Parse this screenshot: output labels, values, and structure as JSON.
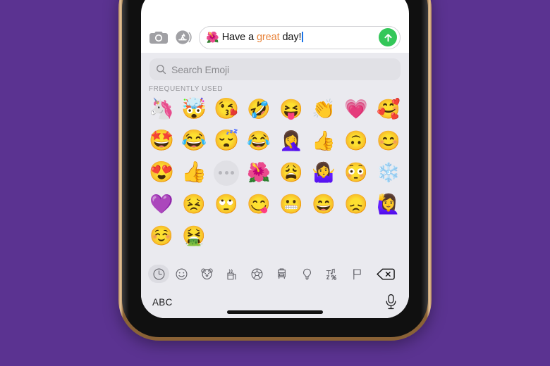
{
  "background": {
    "color": "#5B3391"
  },
  "device": {
    "frame_color": "#b98b5e",
    "bezel_color": "#101010",
    "screen_bg": "#ffffff"
  },
  "compose": {
    "camera_icon": "camera-icon",
    "appstore_icon": "app-store-icon",
    "message_emoji": "🌺",
    "message_text_before": "Have a ",
    "message_text_highlight": "great",
    "message_text_after": " day!",
    "highlight_color": "#E8833A",
    "caret_color": "#1a73e8",
    "send_icon": "send-arrow-up-icon",
    "send_color": "#34C759"
  },
  "keyboard": {
    "background": "#EAEAEF",
    "search": {
      "icon": "search-icon",
      "placeholder": "Search Emoji",
      "value": ""
    },
    "section_header": "FREQUENTLY USED",
    "grid": {
      "columns": 8,
      "items": [
        {
          "glyph": "🦄",
          "name": "memoji-unicorn",
          "type": "memoji"
        },
        {
          "glyph": "🤯",
          "name": "memoji-mind-blown",
          "type": "memoji"
        },
        {
          "glyph": "😘",
          "name": "memoji-blowing-kiss",
          "type": "memoji"
        },
        {
          "glyph": "🤣",
          "name": "emoji-rolling-on-the-floor-laughing",
          "type": "emoji"
        },
        {
          "glyph": "😝",
          "name": "emoji-squinting-face-with-tongue",
          "type": "emoji"
        },
        {
          "glyph": "👏",
          "name": "emoji-clapping-hands",
          "type": "emoji"
        },
        {
          "glyph": "💗",
          "name": "emoji-growing-heart",
          "type": "emoji"
        },
        {
          "glyph": "🥰",
          "name": "emoji-smiling-face-with-hearts",
          "type": "emoji"
        },
        {
          "glyph": "🤩",
          "name": "memoji-star-struck",
          "type": "memoji"
        },
        {
          "glyph": "😂",
          "name": "memoji-tears-of-joy",
          "type": "memoji"
        },
        {
          "glyph": "😴",
          "name": "memoji-sleeping",
          "type": "memoji"
        },
        {
          "glyph": "😂",
          "name": "emoji-face-with-tears-of-joy",
          "type": "emoji"
        },
        {
          "glyph": "🤦‍♀️",
          "name": "emoji-woman-facepalming",
          "type": "emoji"
        },
        {
          "glyph": "👍",
          "name": "emoji-thumbs-up",
          "type": "emoji"
        },
        {
          "glyph": "🙃",
          "name": "emoji-upside-down-face",
          "type": "emoji"
        },
        {
          "glyph": "😊",
          "name": "emoji-smiling-face-with-smiling-eyes",
          "type": "emoji"
        },
        {
          "glyph": "😍",
          "name": "memoji-heart-eyes",
          "type": "memoji"
        },
        {
          "glyph": "👍",
          "name": "memoji-thumbs-up",
          "type": "memoji"
        },
        {
          "glyph": "•••",
          "name": "more-memoji-button",
          "type": "more"
        },
        {
          "glyph": "🌺",
          "name": "emoji-hibiscus",
          "type": "emoji"
        },
        {
          "glyph": "😩",
          "name": "emoji-weary-face",
          "type": "emoji"
        },
        {
          "glyph": "🤷‍♀️",
          "name": "emoji-woman-shrugging",
          "type": "emoji"
        },
        {
          "glyph": "😳",
          "name": "emoji-flushed-face",
          "type": "emoji"
        },
        {
          "glyph": "❄️",
          "name": "emoji-snowflake",
          "type": "emoji"
        },
        {
          "glyph": "💜",
          "name": "emoji-purple-heart",
          "type": "emoji"
        },
        {
          "glyph": "😣",
          "name": "emoji-persevering-face",
          "type": "emoji"
        },
        {
          "glyph": "🙄",
          "name": "emoji-face-with-rolling-eyes",
          "type": "emoji"
        },
        {
          "glyph": "😋",
          "name": "emoji-face-savoring-food",
          "type": "emoji"
        },
        {
          "glyph": "😬",
          "name": "emoji-grimacing-face",
          "type": "emoji"
        },
        {
          "glyph": "😄",
          "name": "emoji-grinning-face-with-smiling-eyes",
          "type": "emoji"
        },
        {
          "glyph": "😞",
          "name": "emoji-disappointed-face",
          "type": "emoji"
        },
        {
          "glyph": "🙋‍♀️",
          "name": "emoji-woman-raising-hand",
          "type": "emoji"
        },
        {
          "glyph": "☺️",
          "name": "emoji-smiling-face",
          "type": "emoji"
        },
        {
          "glyph": "🤮",
          "name": "emoji-face-vomiting",
          "type": "emoji"
        }
      ]
    },
    "categories": [
      {
        "name": "category-frequently-used",
        "icon": "clock-icon",
        "selected": true
      },
      {
        "name": "category-smileys-people",
        "icon": "smiley-icon",
        "selected": false
      },
      {
        "name": "category-animals-nature",
        "icon": "bear-icon",
        "selected": false
      },
      {
        "name": "category-food-drink",
        "icon": "food-icon",
        "selected": false
      },
      {
        "name": "category-activity",
        "icon": "soccer-ball-icon",
        "selected": false
      },
      {
        "name": "category-travel-places",
        "icon": "car-icon",
        "selected": false
      },
      {
        "name": "category-objects",
        "icon": "lightbulb-icon",
        "selected": false
      },
      {
        "name": "category-symbols",
        "icon": "symbols-icon",
        "selected": false
      },
      {
        "name": "category-flags",
        "icon": "flag-icon",
        "selected": false
      }
    ],
    "backspace": {
      "name": "backspace-key",
      "icon": "backspace-icon"
    },
    "bottom": {
      "abc_label": "ABC",
      "mic_icon": "microphone-icon"
    }
  }
}
